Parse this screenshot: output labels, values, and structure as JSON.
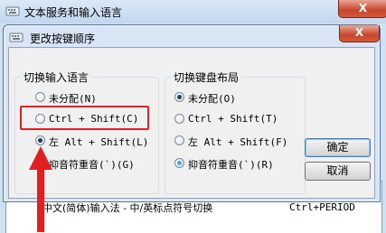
{
  "outer_window": {
    "title": "文本服务和输入语言",
    "close_glyph": "X",
    "row": {
      "text": "中文(简体)输入法 - 中/英标点符号切换",
      "shortcut": "Ctrl+PERIOD"
    }
  },
  "dialog": {
    "title": "更改按键顺序",
    "close_glyph": "X",
    "input_language_group": {
      "title": "切换输入语言",
      "options": [
        {
          "label": "未分配(N)",
          "checked": false
        },
        {
          "label": "Ctrl + Shift(C)",
          "checked": false
        },
        {
          "label": "左 Alt + Shift(L)",
          "checked": true
        },
        {
          "label": "抑音符重音(`)(G)",
          "checked": false
        }
      ]
    },
    "keyboard_layout_group": {
      "title": "切换键盘布局",
      "options": [
        {
          "label": "未分配(O)",
          "checked": true
        },
        {
          "label": "Ctrl + Shift(T)",
          "checked": false
        },
        {
          "label": "左 Alt + Shift(F)",
          "checked": false
        },
        {
          "label": "抑音符重音(`)(R)",
          "checked": false
        }
      ]
    },
    "buttons": {
      "ok": "确定",
      "cancel": "取消"
    }
  },
  "colors": {
    "highlight": "#e02020",
    "arrow": "#e02020"
  }
}
